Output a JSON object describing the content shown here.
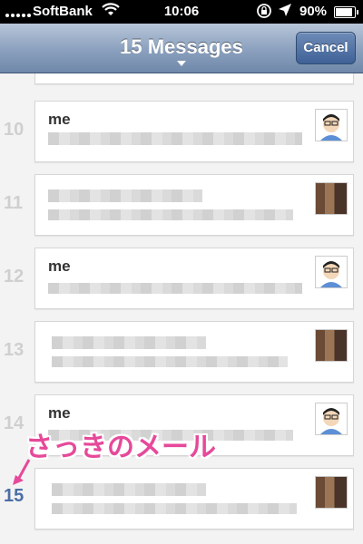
{
  "status_bar": {
    "carrier": "SoftBank",
    "time": "10:06",
    "battery": "90%",
    "battery_level": 0.9,
    "icons": [
      "signal-icon",
      "wifi-icon",
      "rotation-lock-icon",
      "location-icon",
      "battery-icon"
    ]
  },
  "nav": {
    "title": "15 Messages",
    "cancel_label": "Cancel"
  },
  "messages": [
    {
      "number": "10",
      "sender": "me",
      "avatar": "cartoon-avatar-icon"
    },
    {
      "number": "11",
      "sender": "",
      "avatar": "photo-avatar"
    },
    {
      "number": "12",
      "sender": "me",
      "avatar": "cartoon-avatar-icon"
    },
    {
      "number": "13",
      "sender": "",
      "avatar": "photo-avatar"
    },
    {
      "number": "14",
      "sender": "me",
      "avatar": "cartoon-avatar-icon"
    },
    {
      "number": "15",
      "sender": "",
      "avatar": "photo-avatar"
    }
  ],
  "annotation": "さっきのメール",
  "colors": {
    "nav": "#7d95b6",
    "current_number": "#4a6ea6",
    "annotation": "#e6499a"
  }
}
